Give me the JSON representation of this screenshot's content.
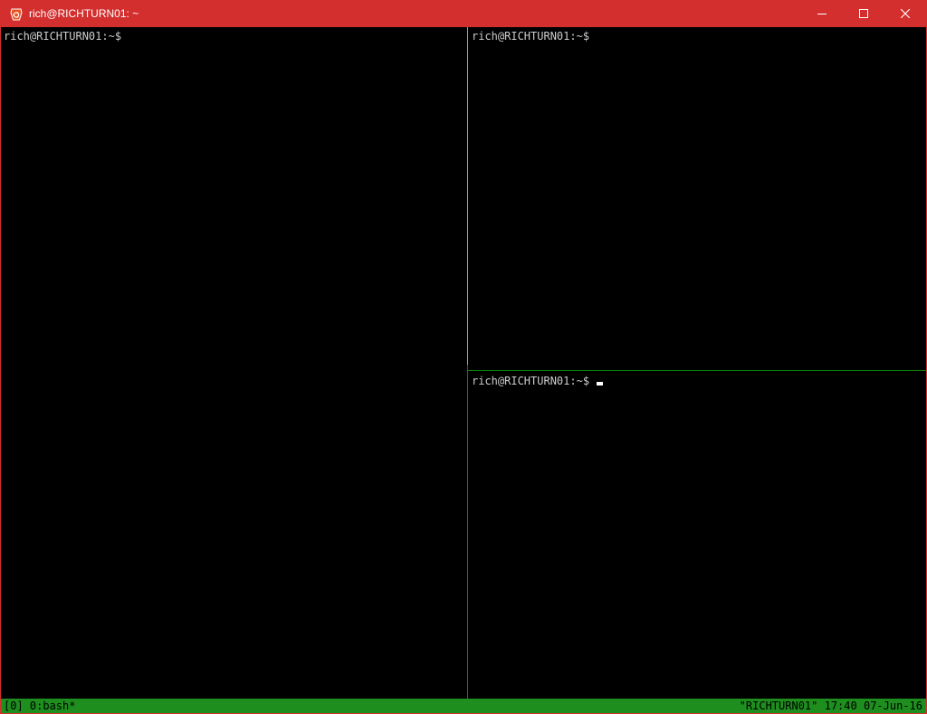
{
  "window": {
    "title": "rich@RICHTURN01: ~",
    "icons": {
      "app": "ubuntu-icon",
      "minimize": "minimize-icon",
      "maximize": "maximize-icon",
      "close": "close-icon"
    },
    "colors": {
      "titlebar": "#d32f2f",
      "status_bar": "#1e8e1e",
      "active_border": "#0a8a0a"
    }
  },
  "panes": {
    "left": {
      "prompt": "rich@RICHTURN01:~$"
    },
    "top_right": {
      "prompt": "rich@RICHTURN01:~$"
    },
    "bottom_right": {
      "prompt": "rich@RICHTURN01:~$",
      "active": true
    }
  },
  "status_bar": {
    "session": "[0] 0:bash*",
    "host": "\"RICHTURN01\"",
    "time": "17:40",
    "date": "07-Jun-16"
  }
}
